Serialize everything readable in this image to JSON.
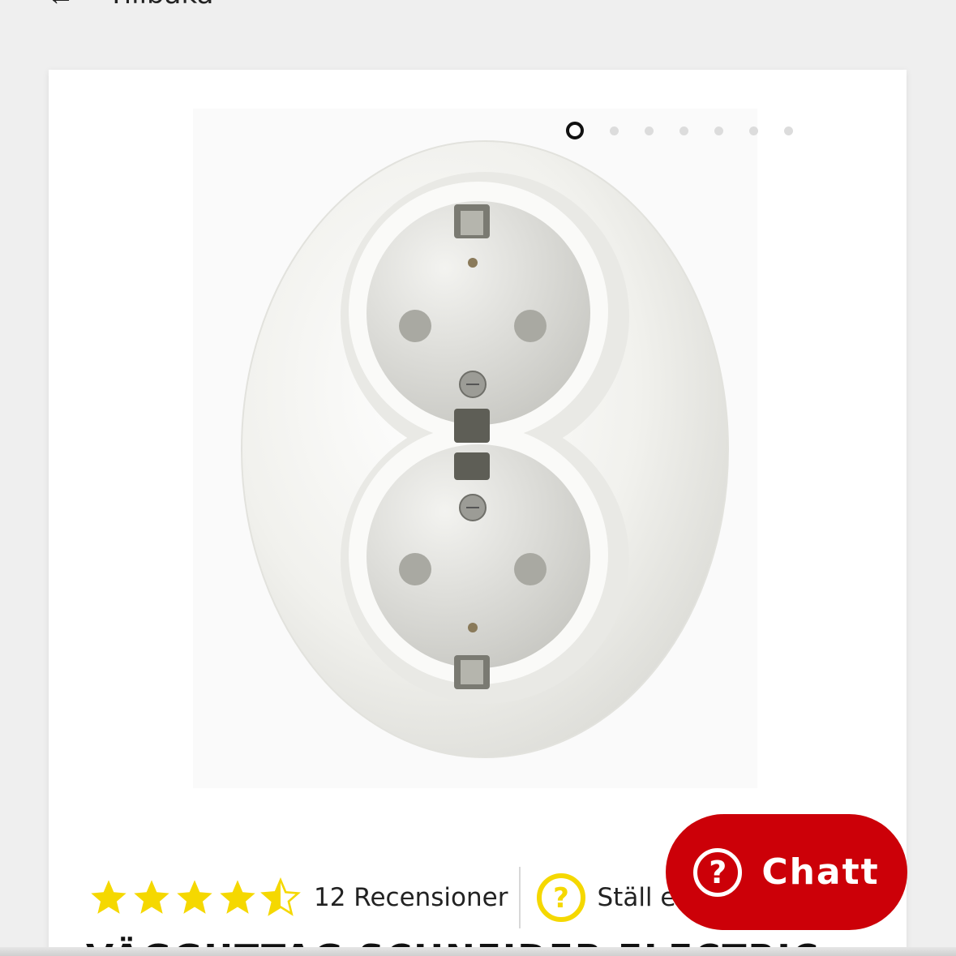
{
  "nav": {
    "back_icon": "arrow-left-icon",
    "back_label": "Tillbaka"
  },
  "gallery": {
    "slide_count": 7,
    "active_index": 0
  },
  "rating": {
    "value": 4.5,
    "max": 5,
    "star_color": "#f5d800",
    "reviews_label": "12 Recensioner"
  },
  "ask": {
    "label": "Ställ en fråga",
    "icon": "question-icon",
    "icon_color": "#f5d800"
  },
  "product": {
    "title": "VÄGGUTTAG SCHNEIDER ELECTRIC"
  },
  "chat": {
    "label": "Chatt",
    "icon": "question-icon",
    "color": "#cc0008"
  }
}
